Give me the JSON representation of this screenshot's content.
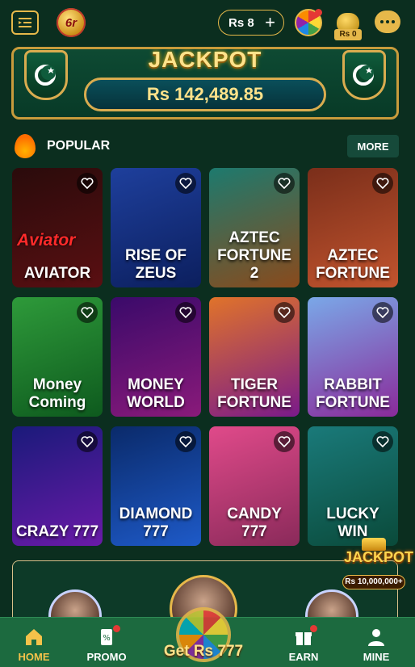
{
  "header": {
    "menu_icon": "menu-icon",
    "logo_text": "6r",
    "balance": "Rs 8",
    "plus": "+",
    "wheel_icon": "lucky-wheel-icon",
    "bag_label": "Rs 0",
    "chat_icon": "chat-icon"
  },
  "jackpot": {
    "title": "JACKPOT",
    "amount": "Rs 142,489.85"
  },
  "popular": {
    "title": "POPULAR",
    "more": "MORE",
    "games": [
      {
        "name": "AVIATOR",
        "logo": "Aviator",
        "colors": [
          "#2a0b0b",
          "#5a0f12"
        ]
      },
      {
        "name": "RISE OF ZEUS",
        "colors": [
          "#1e3f9c",
          "#0c1f5e"
        ]
      },
      {
        "name": "AZTEC FORTUNE 2",
        "colors": [
          "#1d7a6e",
          "#8a4a1c"
        ]
      },
      {
        "name": "AZTEC FORTUNE",
        "colors": [
          "#7a2e1a",
          "#c2542e"
        ]
      },
      {
        "name": "Money Coming",
        "colors": [
          "#2e9a3a",
          "#0e5a1e"
        ]
      },
      {
        "name": "MONEY WORLD",
        "colors": [
          "#3a0a6a",
          "#8a1a7a"
        ]
      },
      {
        "name": "TIGER FORTUNE",
        "colors": [
          "#e0732a",
          "#7a1a8a"
        ]
      },
      {
        "name": "RABBIT FORTUNE",
        "colors": [
          "#7aa8e8",
          "#8a2a9a"
        ]
      },
      {
        "name": "CRAZY 777",
        "colors": [
          "#1a1a7a",
          "#6a1aa8"
        ]
      },
      {
        "name": "DIAMOND 777",
        "colors": [
          "#0a2a6a",
          "#1e5ac8"
        ]
      },
      {
        "name": "CANDY 777",
        "colors": [
          "#e04a8a",
          "#8a2a5a"
        ]
      },
      {
        "name": "LUCKY WIN",
        "colors": [
          "#1a7a7a",
          "#0a4a3a"
        ]
      }
    ]
  },
  "float_jackpot": {
    "title": "JACKPOT",
    "amount": "Rs 10,000,000+"
  },
  "bottom_nav": {
    "items": [
      {
        "label": "HOME",
        "icon": "home-icon"
      },
      {
        "label": "PROMO",
        "icon": "promo-icon"
      },
      {
        "label": "EARN",
        "icon": "gift-icon"
      },
      {
        "label": "MINE",
        "icon": "user-icon"
      }
    ],
    "center_text": "Get Rs 777"
  },
  "colors": {
    "background": "#0b2e1f",
    "gold": "#e6b84a",
    "nav_bg": "#1c6a3f",
    "active": "#f5c24a"
  }
}
